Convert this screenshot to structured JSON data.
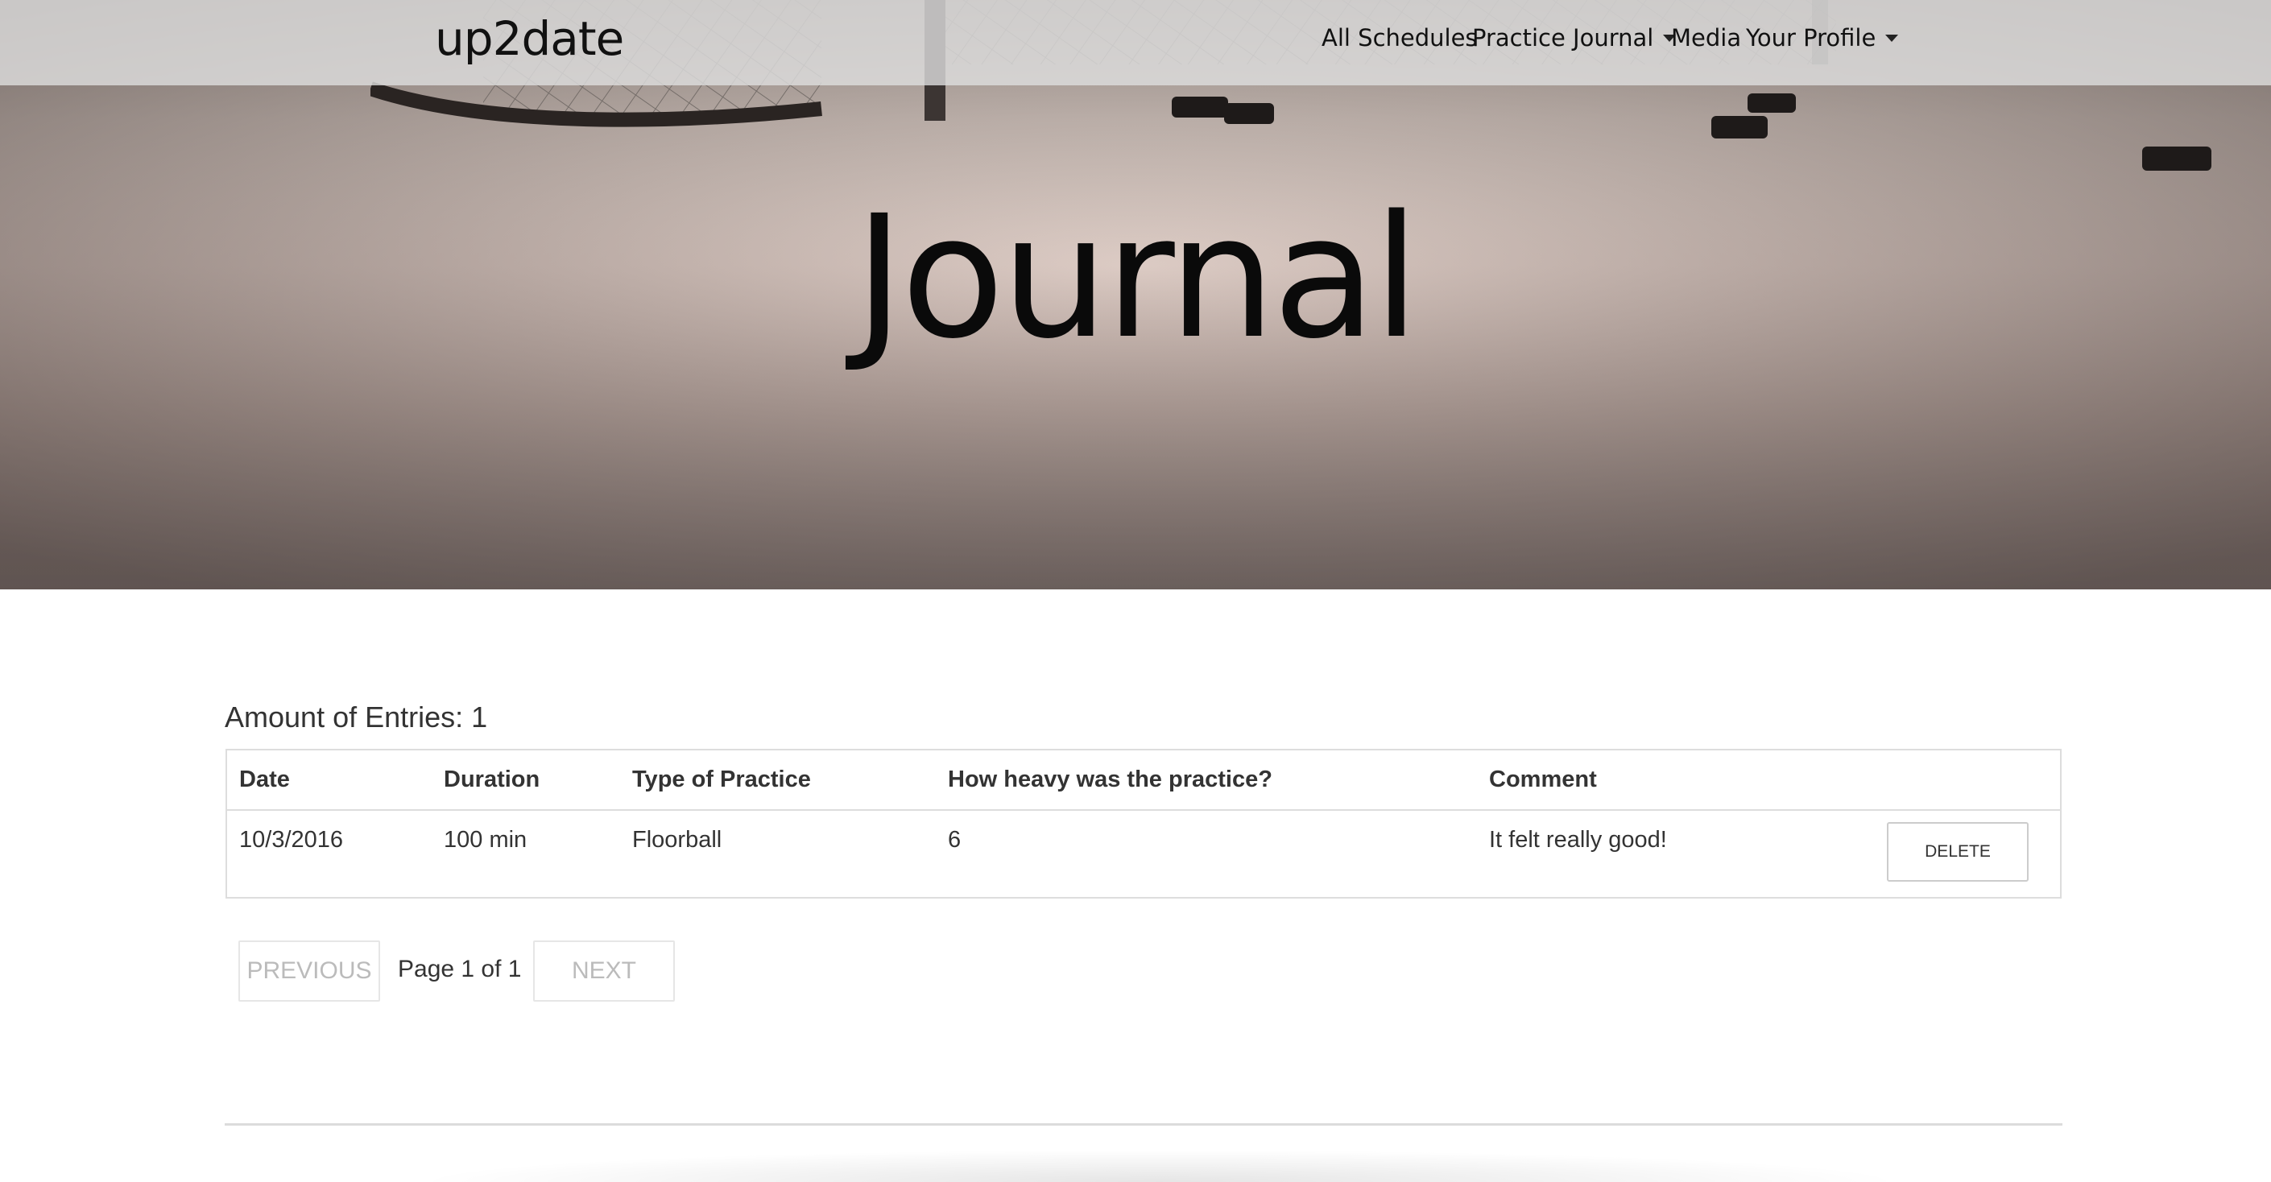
{
  "navbar": {
    "brand": "up2date",
    "items": [
      {
        "label": "All Schedules",
        "dropdown": false
      },
      {
        "label": "Practice Journal",
        "dropdown": true
      },
      {
        "label": "Media",
        "dropdown": false
      },
      {
        "label": "Your Profile",
        "dropdown": true
      }
    ]
  },
  "hero": {
    "title": "Journal"
  },
  "entries": {
    "heading": "Amount of Entries: 1",
    "columns": [
      "Date",
      "Duration",
      "Type of Practice",
      "How heavy was the practice?",
      "Comment"
    ],
    "rows": [
      {
        "date": "10/3/2016",
        "duration": "100 min",
        "type": "Floorball",
        "heaviness": "6",
        "comment": "It felt really good!",
        "action_label": "DELETE"
      }
    ]
  },
  "pagination": {
    "previous_label": "PREVIOUS",
    "page_label": "Page 1 of 1",
    "next_label": "NEXT"
  }
}
